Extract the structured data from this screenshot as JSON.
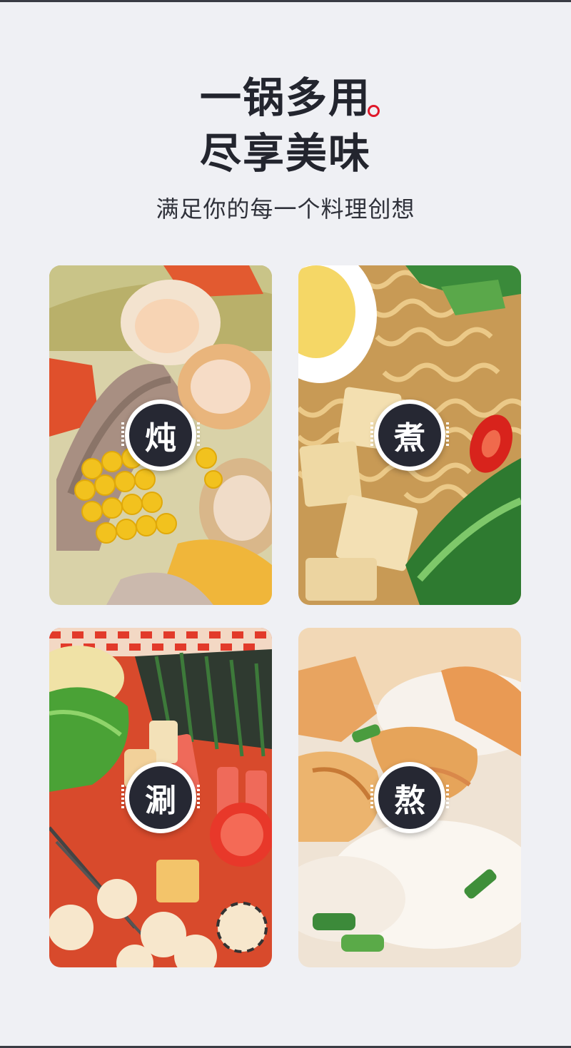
{
  "header": {
    "line1": "一锅多用",
    "line2": "尽享美味",
    "subtitle": "满足你的每一个料理创想",
    "accent_color": "#e0182a"
  },
  "cards": [
    {
      "label": "炖",
      "image": "seafood-bone-soup-with-corn"
    },
    {
      "label": "煮",
      "image": "ramen-with-tofu-egg-and-chili"
    },
    {
      "label": "涮",
      "image": "spicy-hotpot-with-skewers"
    },
    {
      "label": "熬",
      "image": "creamy-soup-with-fried-dumplings"
    }
  ]
}
